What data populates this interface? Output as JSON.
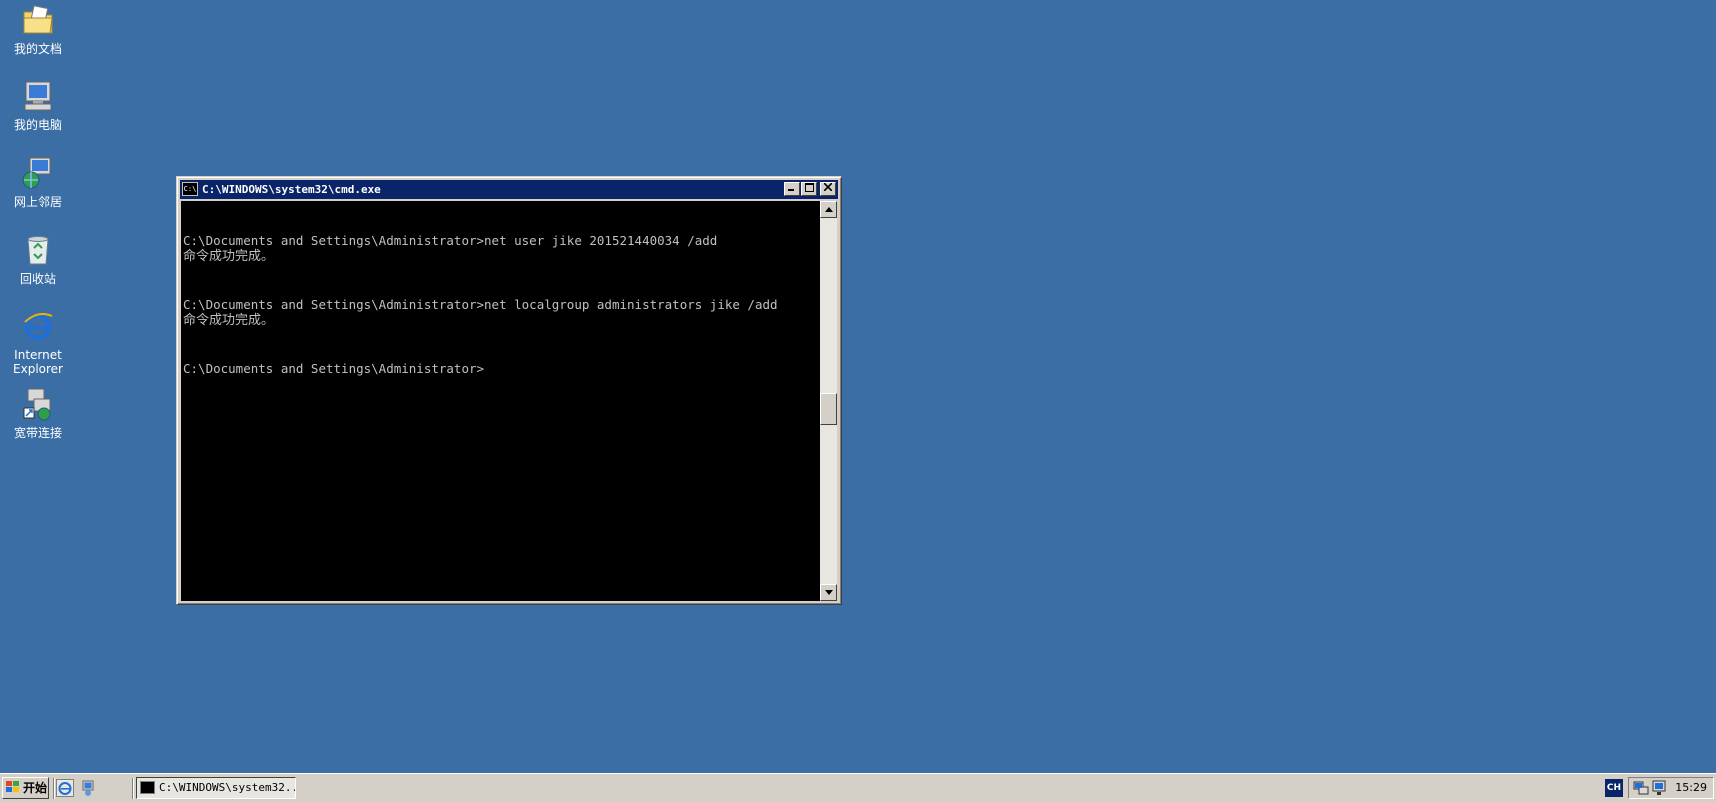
{
  "desktop": {
    "icons": [
      {
        "label": "我的文档",
        "icon": "my-documents-icon"
      },
      {
        "label": "我的电脑",
        "icon": "my-computer-icon"
      },
      {
        "label": "网上邻居",
        "icon": "network-places-icon"
      },
      {
        "label": "回收站",
        "icon": "recycle-bin-icon"
      },
      {
        "label": "Internet Explorer",
        "icon": "internet-explorer-icon"
      },
      {
        "label": "宽带连接",
        "icon": "broadband-connection-icon"
      }
    ]
  },
  "window": {
    "title": "C:\\WINDOWS\\system32\\cmd.exe",
    "icon_text": "C:\\",
    "console_lines": [
      "",
      "",
      "C:\\Documents and Settings\\Administrator>net user jike 201521440034 /add",
      "命令成功完成。",
      "",
      "",
      "C:\\Documents and Settings\\Administrator>net localgroup administrators jike /add",
      "命令成功完成。",
      "",
      "",
      "C:\\Documents and Settings\\Administrator>"
    ],
    "colors": {
      "titlebar": "#0a246a",
      "console_bg": "#000000",
      "console_fg": "#c0c0c0"
    }
  },
  "taskbar": {
    "start_label": "开始",
    "task_button_label": "C:\\WINDOWS\\system32...",
    "language": "CH",
    "clock": "15:29"
  }
}
